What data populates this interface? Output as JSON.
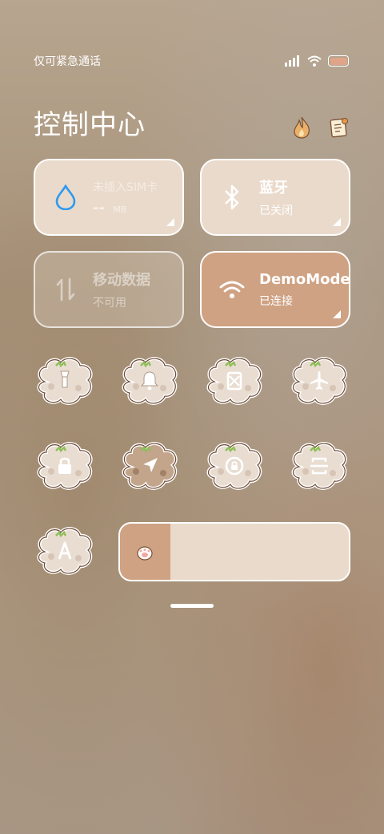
{
  "status_bar": {
    "carrier": "仅可紧急通话",
    "icons": [
      "signal-icon",
      "wifi-icon",
      "battery-icon"
    ],
    "battery_color": "#e0a488"
  },
  "header": {
    "title": "控制中心",
    "icons": [
      "flame-icon",
      "edit-note-icon"
    ]
  },
  "tiles": {
    "data_usage": {
      "label": "未插入SIM卡",
      "value": "--",
      "unit": "MB",
      "icon": "water-drop-icon"
    },
    "bluetooth": {
      "label": "蓝牙",
      "status": "已关闭",
      "icon": "bluetooth-icon"
    },
    "mobile_data": {
      "label": "移动数据",
      "status": "不可用",
      "icon": "mobile-data-icon"
    },
    "wifi": {
      "label": "DemoMode",
      "status": "已连接",
      "icon": "wifi-icon"
    }
  },
  "toggles": [
    {
      "name": "flashlight",
      "icon": "flashlight-icon",
      "active": false
    },
    {
      "name": "ring",
      "icon": "bell-icon",
      "active": false
    },
    {
      "name": "screenshot",
      "icon": "screenshot-icon",
      "active": false
    },
    {
      "name": "airplane",
      "icon": "airplane-icon",
      "active": false
    },
    {
      "name": "lock-screen",
      "icon": "lock-icon",
      "active": false
    },
    {
      "name": "location",
      "icon": "location-arrow-icon",
      "active": true
    },
    {
      "name": "rotation-lock",
      "icon": "rotation-lock-icon",
      "active": false
    },
    {
      "name": "scanner",
      "icon": "scanner-icon",
      "active": false
    },
    {
      "name": "auto-brightness",
      "icon": "auto-brightness-icon",
      "active": false
    }
  ],
  "brightness": {
    "level": 0.22,
    "icon": "paw-icon"
  },
  "colors": {
    "tile_bg": "#eadacb",
    "tile_text": "#ffffff",
    "wifi_tile_bg": "#cfa283",
    "disabled_tile_bg": "rgba(225,210,195,0.45)",
    "accent_blue": "#2e9af0",
    "slider_fill": "#cfa283"
  }
}
